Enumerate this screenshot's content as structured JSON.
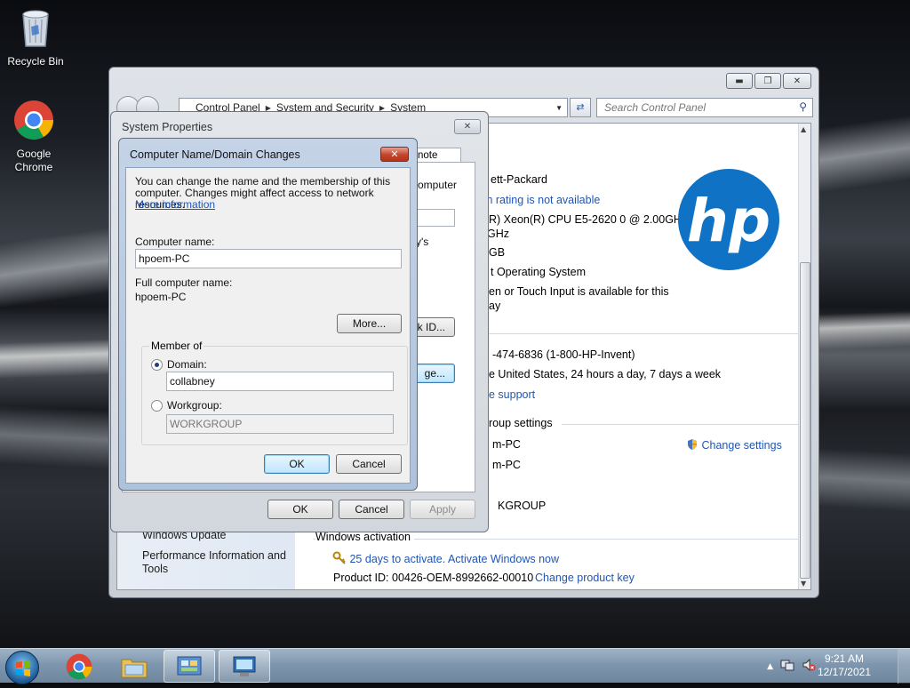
{
  "desktop": {
    "icons": [
      {
        "label": "Recycle Bin"
      },
      {
        "label": "Google Chrome"
      }
    ]
  },
  "control_panel": {
    "breadcrumb": [
      "Control Panel",
      "System and Security",
      "System"
    ],
    "search_placeholder": "Search Control Panel",
    "left_links": [
      "Windows Update",
      "Performance Information and Tools"
    ],
    "fragments": {
      "manufacturer": "ett-Packard",
      "rating": "m rating is not available",
      "processor_1": "R) Xeon(R) CPU E5-2620 0 @ 2.00GHz",
      "processor_2": "GHz",
      "memory": "GB",
      "system_type": "t Operating System",
      "pen_1": "en or Touch Input is available for this",
      "pen_2": "ay",
      "phone": "-474-6836 (1-800-HP-Invent)",
      "hours": "e United States, 24 hours a day, 7 days a week",
      "support": "e support",
      "group_settings": "roup settings",
      "name_1": "m-PC",
      "name_2": "m-PC",
      "workgroup": "KGROUP"
    },
    "change_settings": "Change settings",
    "windows_activation": "Windows activation",
    "activate_link": "25 days to activate. Activate Windows now",
    "product_id": "Product ID: 00426-OEM-8992662-00010",
    "change_product_key": "Change product key",
    "brand_colors": {
      "hp_blue": "#0f72c4"
    }
  },
  "system_properties": {
    "title": "System Properties",
    "tab_fragment": "note",
    "fragments": {
      "computer": "omputer",
      "y_s": "y's",
      "id_btn": "k ID...",
      "change_btn": "ge..."
    },
    "ok": "OK",
    "cancel": "Cancel",
    "apply": "Apply"
  },
  "computer_name_dialog": {
    "title": "Computer Name/Domain Changes",
    "description": "You can change the name and the membership of this computer. Changes might affect access to network resources.",
    "more_information": "More information",
    "computer_name_label": "Computer name:",
    "computer_name_value": "hpoem-PC",
    "full_name_label": "Full computer name:",
    "full_name_value": "hpoem-PC",
    "more_button": "More...",
    "member_of": "Member of",
    "domain_label": "Domain:",
    "domain_value": "collabney",
    "workgroup_label": "Workgroup:",
    "workgroup_value": "WORKGROUP",
    "selected": "Domain",
    "ok": "OK",
    "cancel": "Cancel"
  },
  "taskbar": {
    "time": "9:21 AM",
    "date": "12/17/2021"
  }
}
